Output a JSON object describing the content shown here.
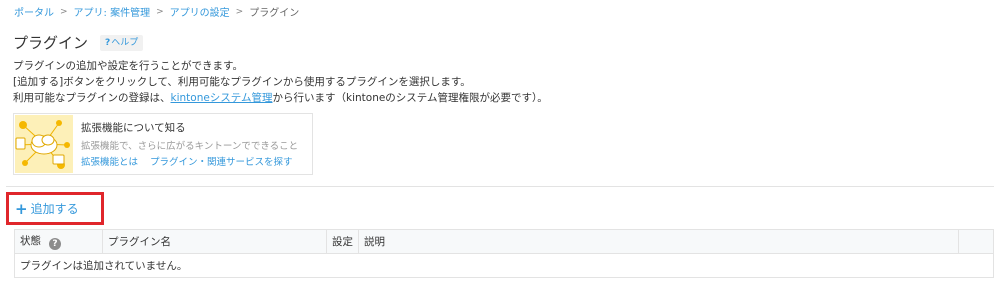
{
  "breadcrumb": {
    "portal": "ポータル",
    "app": "アプリ: 案件管理",
    "settings": "アプリの設定",
    "current": "プラグイン",
    "separator": ">"
  },
  "page": {
    "title": "プラグイン",
    "help_mark": "?",
    "help_label": "ヘルプ"
  },
  "description": {
    "line1": "プラグインの追加や設定を行うことができます。",
    "line2": "[追加する]ボタンをクリックして、利用可能なプラグインから使用するプラグインを選択します。",
    "line3_prefix": "利用可能なプラグインの登録は、",
    "line3_link": "kintoneシステム管理",
    "line3_suffix": "から行います（kintoneのシステム管理権限が必要です）。"
  },
  "promo": {
    "title": "拡張機能について知る",
    "subtitle": "拡張機能で、さらに広がるキントーンでできること",
    "link1": "拡張機能とは",
    "link2": "プラグイン・関連サービスを探す"
  },
  "add_button": {
    "icon": "plus-icon",
    "label": "追加する"
  },
  "table": {
    "columns": {
      "status": "状態",
      "status_help": "?",
      "name": "プラグイン名",
      "settings": "設定",
      "description": "説明"
    },
    "empty_message": "プラグインは追加されていません。"
  },
  "colors": {
    "link": "#3498db",
    "highlight": "#e0262b",
    "header_bg": "#f7f9fa",
    "border": "#e3e3e3"
  }
}
